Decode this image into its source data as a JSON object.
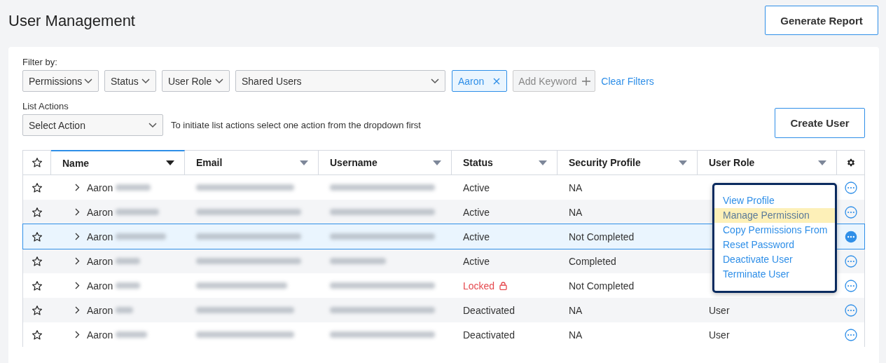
{
  "header": {
    "title": "User Management",
    "report_button": "Generate Report"
  },
  "filters": {
    "label": "Filter by:",
    "dropdowns": [
      {
        "label": "Permissions"
      },
      {
        "label": "Status"
      },
      {
        "label": "User Role"
      },
      {
        "label": "Shared Users"
      }
    ],
    "keyword_chip": {
      "label": "Aaron"
    },
    "add_keyword": {
      "placeholder": "Add Keyword"
    },
    "clear_link": "Clear Filters"
  },
  "list_actions": {
    "label": "List Actions",
    "select": "Select Action",
    "hint": "To initiate list actions select one action from the dropdown first",
    "create_button": "Create User"
  },
  "table": {
    "columns": [
      {
        "label": "Name",
        "sorted": true
      },
      {
        "label": "Email",
        "sorted": false
      },
      {
        "label": "Username",
        "sorted": false
      },
      {
        "label": "Status",
        "sorted": false
      },
      {
        "label": "Security Profile",
        "sorted": false
      },
      {
        "label": "User Role",
        "sorted": false
      }
    ],
    "rows": [
      {
        "name": "Aaron",
        "status": "Active",
        "locked": false,
        "security_profile": "NA",
        "selected": false,
        "menu_open": false
      },
      {
        "name": "Aaron",
        "status": "Active",
        "locked": false,
        "security_profile": "NA",
        "selected": false,
        "menu_open": false
      },
      {
        "name": "Aaron",
        "status": "Active",
        "locked": false,
        "security_profile": "Not Completed",
        "selected": true,
        "menu_open": true
      },
      {
        "name": "Aaron",
        "status": "Active",
        "locked": false,
        "security_profile": "Completed",
        "selected": false,
        "menu_open": false
      },
      {
        "name": "Aaron",
        "status": "Locked",
        "locked": true,
        "security_profile": "Not Completed",
        "selected": false,
        "menu_open": false
      },
      {
        "name": "Aaron",
        "status": "Deactivated",
        "locked": false,
        "security_profile": "NA",
        "user_role": "User",
        "selected": false,
        "menu_open": false
      },
      {
        "name": "Aaron",
        "status": "Deactivated",
        "locked": false,
        "security_profile": "NA",
        "user_role": "User",
        "selected": false,
        "menu_open": false
      }
    ]
  },
  "row_menu": {
    "items": [
      {
        "label": "View Profile",
        "selected": false
      },
      {
        "label": "Manage Permission",
        "selected": true
      },
      {
        "label": "Copy Permissions From",
        "selected": false
      },
      {
        "label": "Reset Password",
        "selected": false
      },
      {
        "label": "Deactivate User",
        "selected": false
      },
      {
        "label": "Terminate User",
        "selected": false
      }
    ]
  }
}
